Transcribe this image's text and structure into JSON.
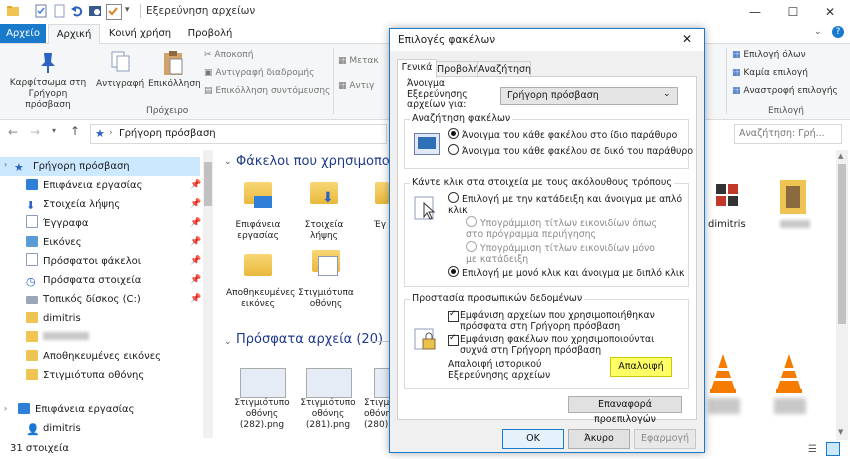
{
  "window": {
    "title": "Εξερεύνηση αρχείων",
    "minimize_glyph": "—",
    "maximize_glyph": "☐",
    "close_glyph": "✕"
  },
  "tabs": [
    "Αρχείο",
    "Αρχική",
    "Κοινή χρήση",
    "Προβολή"
  ],
  "ribbon": {
    "pin_label": "Καρφίτσωμα στη Γρήγορη πρόσβαση",
    "copy_label": "Αντιγραφή",
    "paste_label": "Επικόλληση",
    "cut": "Αποκοπή",
    "copy_path": "Αντιγραφή διαδρομής",
    "paste_shortcut": "Επικόλληση συντόμευσης",
    "clipboard_group": "Πρόχειρο",
    "move_label": "Μετακ",
    "copy_to_label": "Αντιγ",
    "select_all": "Επιλογή όλων",
    "select_none": "Καμία επιλογή",
    "invert_selection": "Αναστροφή επιλογής",
    "select_group": "Επιλογή"
  },
  "address": {
    "path": "Γρήγορη πρόσβαση",
    "search_placeholder": "Αναζήτηση: Γρή..."
  },
  "nav": {
    "items": [
      {
        "label": "Γρήγορη πρόσβαση",
        "pinned": false
      },
      {
        "label": "Επιφάνεια εργασίας",
        "pinned": true
      },
      {
        "label": "Στοιχεία λήψης",
        "pinned": true
      },
      {
        "label": "Έγγραφα",
        "pinned": true
      },
      {
        "label": "Εικόνες",
        "pinned": true
      },
      {
        "label": "Πρόσφατοι φάκελοι",
        "pinned": true
      },
      {
        "label": "Πρόσφατα στοιχεία",
        "pinned": true
      },
      {
        "label": "Τοπικός δίσκος (C:)",
        "pinned": true
      },
      {
        "label": "dimitris",
        "pinned": false
      },
      {
        "label": "Αποθηκευμένες εικόνες",
        "pinned": false
      },
      {
        "label": "Στιγμιότυπα οθόνης",
        "pinned": false
      },
      {
        "label": "Επιφάνεια εργασίας",
        "pinned": false
      },
      {
        "label": "dimitris",
        "pinned": false
      }
    ]
  },
  "content": {
    "frequent_header": "Φάκελοι που χρησιμοποιο",
    "recent_header": "Πρόσφατα αρχεία (20)",
    "folders": [
      {
        "name": "Επιφάνεια εργασίας"
      },
      {
        "name": "Στοιχεία λήψης"
      },
      {
        "name": "Έγ"
      },
      {
        "name": "Αποθηκευμένες εικόνες"
      },
      {
        "name": "Στιγμιότυπα οθόνης"
      },
      {
        "name": "dimitris"
      }
    ],
    "files": [
      {
        "name": "Στιγμιότυπο οθόνης (282).png"
      },
      {
        "name": "Στιγμιότυπο οθόνης (281).png"
      },
      {
        "name": "Στιγμιότυπο οθόνης (280).png"
      }
    ]
  },
  "status": {
    "count": "31 στοιχεία"
  },
  "dialog": {
    "title": "Επιλογές φακέλων",
    "tabs": [
      "Γενικά",
      "Προβολή",
      "Αναζήτηση"
    ],
    "open_label": "Άνοιγμα Εξερεύνησης αρχείων για:",
    "open_value": "Γρήγορη πρόσβαση",
    "browse_group": "Αναζήτηση φακέλων",
    "browse_same": "Άνοιγμα του κάθε φακέλου στο ίδιο παράθυρο",
    "browse_new": "Άνοιγμα του κάθε φακέλου σε δικό του παράθυρο",
    "click_group": "Κάντε κλικ στα στοιχεία με τους ακόλουθους τρόπους",
    "single_click": "Επιλογή με την κατάδειξη και άνοιγμα με απλό κλικ",
    "underline_browser": "Υπογράμμιση τίτλων εικονιδίων όπως στο πρόγραμμα περιήγησης",
    "underline_point": "Υπογράμμιση τίτλων εικονιδίων μόνο με κατάδειξη",
    "double_click": "Επιλογή με μονό κλικ και άνοιγμα με διπλό κλικ",
    "privacy_group": "Προστασία προσωπικών δεδομένων",
    "show_recent_files": "Εμφάνιση αρχείων που χρησιμοποιήθηκαν πρόσφατα στη Γρήγορη πρόσβαση",
    "show_frequent_folders": "Εμφάνιση φακέλων που χρησιμοποιούνται συχνά στη Γρήγορη πρόσβαση",
    "clear_history_label": "Απαλοιφή ιστορικού Εξερεύνησης αρχείων",
    "clear_button": "Απαλοιφή",
    "restore_defaults": "Επαναφορά προεπιλογών",
    "ok": "OK",
    "cancel": "Άκυρο",
    "apply": "Εφαρμογή"
  },
  "colors": {
    "accent": "#1979ca",
    "highlight": "#ffff66",
    "folder": "#f0c453"
  }
}
